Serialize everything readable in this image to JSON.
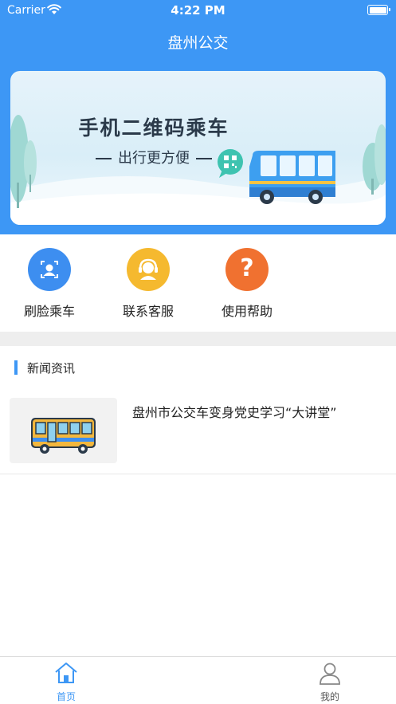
{
  "status_bar": {
    "carrier": "Carrier",
    "time": "4:22 PM"
  },
  "nav": {
    "title": "盘州公交"
  },
  "banner": {
    "title": "手机二维码乘车",
    "subtitle": "出行更方便"
  },
  "actions": [
    {
      "label": "刷脸乘车",
      "icon": "face-scan-icon",
      "color": "#3d8ef0"
    },
    {
      "label": "联系客服",
      "icon": "headset-icon",
      "color": "#f5b92f"
    },
    {
      "label": "使用帮助",
      "icon": "question-icon",
      "color": "#f07130",
      "glyph": "?"
    }
  ],
  "news": {
    "heading": "新闻资讯",
    "items": [
      {
        "title": "盘州市公交车变身党史学习“大讲堂”",
        "thumb_icon": "bus-icon"
      }
    ]
  },
  "tabbar": {
    "active_color": "#3d97f5",
    "inactive_color": "#555555",
    "tabs": [
      {
        "label": "首页",
        "icon": "home-icon",
        "active": true
      },
      {
        "label": "我的",
        "icon": "user-icon",
        "active": false
      }
    ]
  }
}
